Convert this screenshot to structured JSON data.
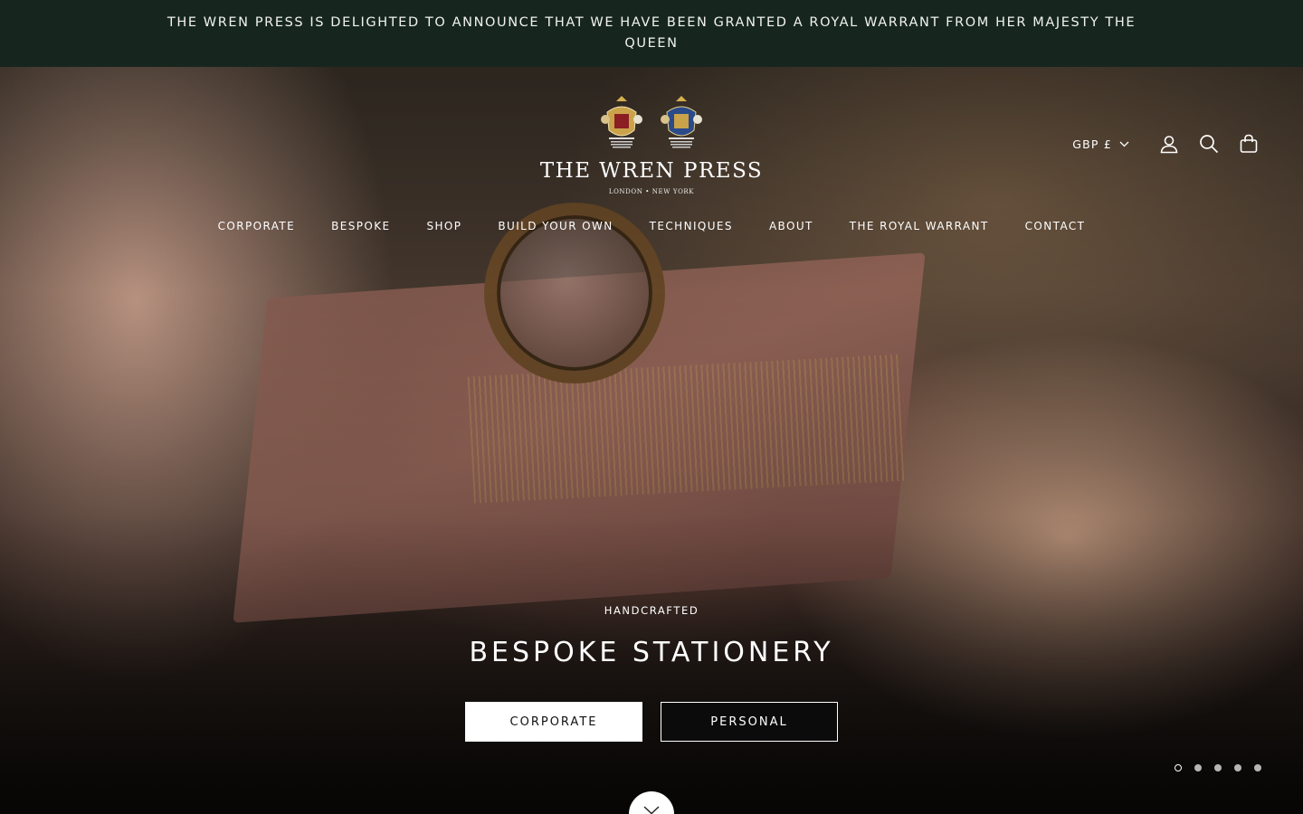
{
  "announcement": {
    "text": "THE WREN PRESS IS DELIGHTED TO ANNOUNCE THAT WE HAVE BEEN GRANTED A ROYAL WARRANT FROM HER MAJESTY THE QUEEN"
  },
  "header": {
    "logo_title": "THE WREN PRESS",
    "logo_subtitle": "LONDON • NEW YORK",
    "currency": "GBP £",
    "icons": [
      "account-icon",
      "search-icon",
      "bag-icon"
    ]
  },
  "nav": {
    "items": [
      "CORPORATE",
      "BESPOKE",
      "SHOP",
      "BUILD YOUR OWN",
      "TECHNIQUES",
      "ABOUT",
      "THE ROYAL WARRANT",
      "CONTACT"
    ]
  },
  "hero": {
    "kicker": "HANDCRAFTED",
    "title": "BESPOKE STATIONERY",
    "buttons": {
      "corporate": "CORPORATE",
      "personal": "PERSONAL"
    },
    "slide_count": 5,
    "active_slide": 1
  },
  "colors": {
    "announcement_bg": "#16261f",
    "text": "#ffffff",
    "button_light": "#ffffff",
    "button_dark": "#0b0b0b"
  }
}
